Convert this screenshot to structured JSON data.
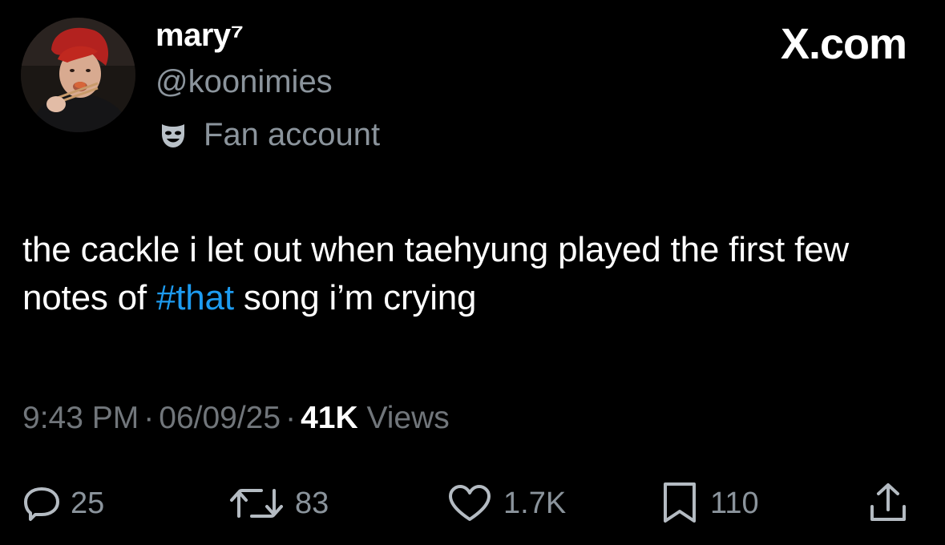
{
  "user": {
    "display_name": "mary⁷",
    "handle": "@koonimies",
    "label": "Fan account",
    "label_icon": "theater-mask-icon"
  },
  "brand": "X.com",
  "tweet": {
    "text_before": "the cackle i let out when taehyung played the first few notes of ",
    "hashtag": "#that",
    "text_after": " song i’m crying"
  },
  "meta": {
    "time": "9:43 PM",
    "date": "06/09/25",
    "views_count": "41K",
    "views_label": "Views"
  },
  "actions": {
    "replies": "25",
    "reposts": "83",
    "likes": "1.7K",
    "bookmarks": "110"
  },
  "colors": {
    "background": "#000000",
    "text": "#ffffff",
    "muted": "#71767b",
    "link": "#1d9bf0"
  }
}
